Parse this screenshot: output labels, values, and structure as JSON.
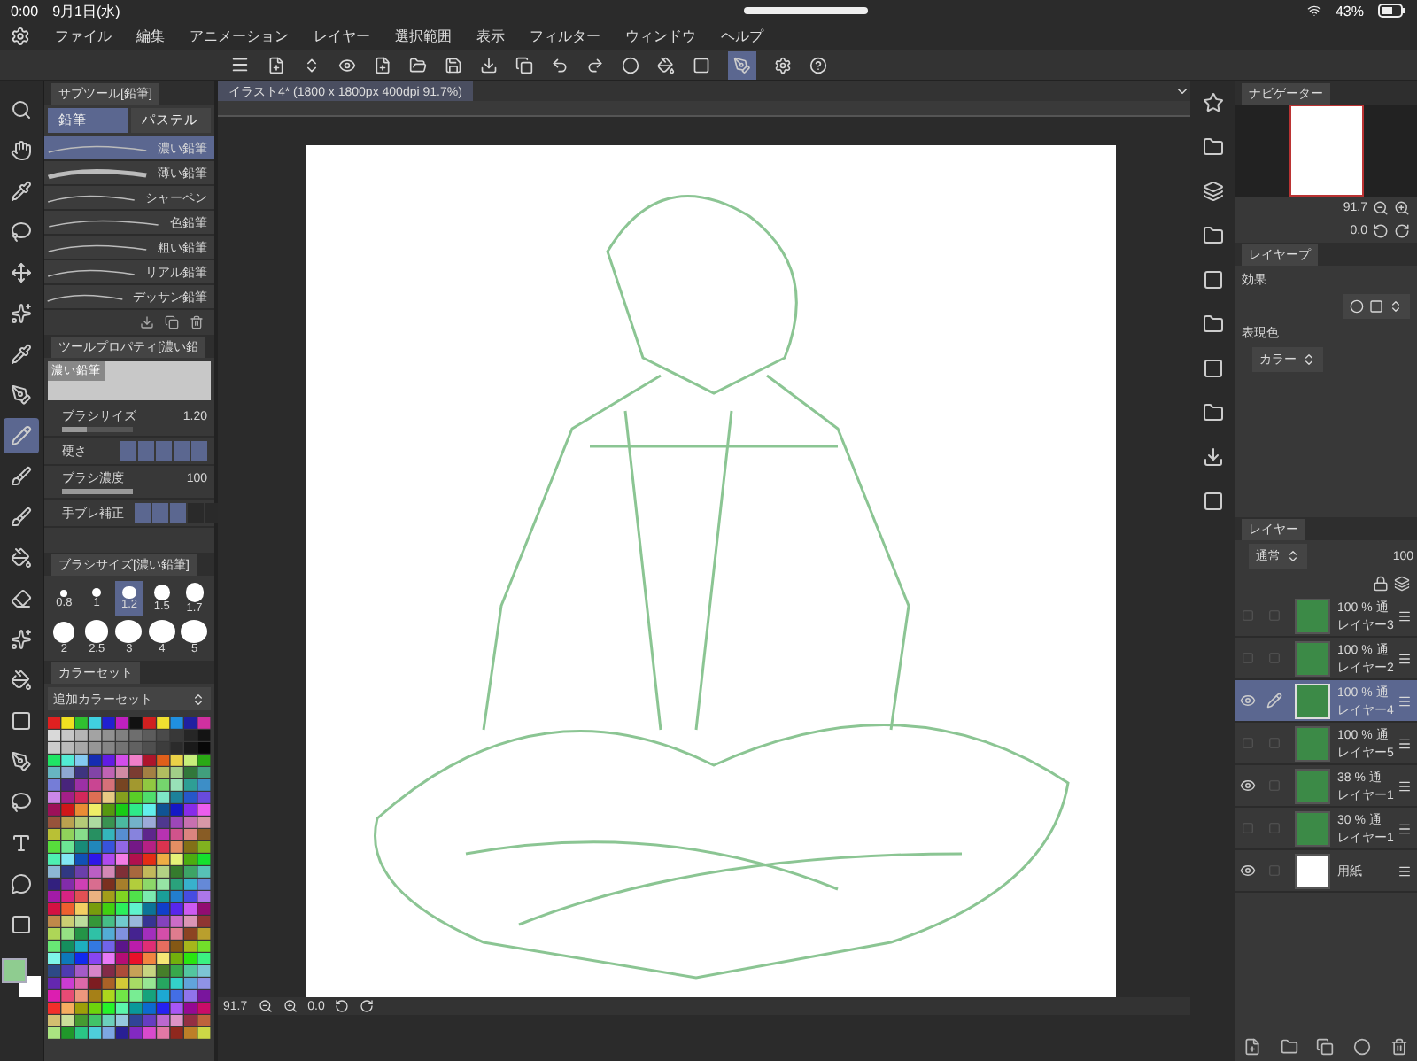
{
  "status_bar": {
    "time": "0:00",
    "date": "9月1日(水)",
    "battery": "43%"
  },
  "menu": [
    "ファイル",
    "編集",
    "アニメーション",
    "レイヤー",
    "選択範囲",
    "表示",
    "フィルター",
    "ウィンドウ",
    "ヘルプ"
  ],
  "tools": [
    {
      "selected": false
    },
    {
      "selected": false
    },
    {
      "selected": false
    },
    {
      "selected": false
    },
    {
      "selected": false
    },
    {
      "selected": false
    },
    {
      "selected": false
    },
    {
      "selected": false
    },
    {
      "selected": true
    },
    {
      "selected": false
    },
    {
      "selected": false
    },
    {
      "selected": false
    },
    {
      "selected": false
    },
    {
      "selected": false
    },
    {
      "selected": false
    },
    {
      "selected": false
    },
    {
      "selected": false
    },
    {
      "selected": false
    },
    {
      "selected": false
    },
    {
      "selected": false
    },
    {
      "selected": false
    }
  ],
  "subtool_panel": {
    "title": "サブツール[鉛筆]",
    "groups": [
      {
        "label": "鉛筆",
        "selected": true
      },
      {
        "label": "パステル",
        "selected": false
      }
    ],
    "brushes": [
      {
        "name": "濃い鉛筆",
        "selected": true
      },
      {
        "name": "薄い鉛筆",
        "selected": false
      },
      {
        "name": "シャーペン",
        "selected": false
      },
      {
        "name": "色鉛筆",
        "selected": false
      },
      {
        "name": "粗い鉛筆",
        "selected": false
      },
      {
        "name": "リアル鉛筆",
        "selected": false
      },
      {
        "name": "デッサン鉛筆",
        "selected": false
      }
    ]
  },
  "tool_property": {
    "title": "ツールプロパティ[濃い鉛",
    "preview_label": "濃い鉛筆",
    "rows": [
      {
        "kind": "value",
        "label": "ブラシサイズ",
        "value": "1.20",
        "level": 0.35
      },
      {
        "kind": "steps",
        "label": "硬さ",
        "level": 1
      },
      {
        "kind": "value",
        "label": "ブラシ濃度",
        "value": "100",
        "level": 1
      },
      {
        "kind": "steps",
        "label": "手ブレ補正",
        "level": 0.6
      }
    ]
  },
  "brush_size": {
    "title": "ブラシサイズ[濃い鉛筆]",
    "sizes": [
      {
        "label": "0.8",
        "selected": false
      },
      {
        "label": "1",
        "selected": false
      },
      {
        "label": "1.2",
        "selected": true
      },
      {
        "label": "1.5",
        "selected": false
      },
      {
        "label": "1.7",
        "selected": false
      },
      {
        "label": "2",
        "selected": false
      },
      {
        "label": "2.5",
        "selected": false
      },
      {
        "label": "3",
        "selected": false
      },
      {
        "label": "4",
        "selected": false
      },
      {
        "label": "5",
        "selected": false
      }
    ]
  },
  "color_set": {
    "title": "カラーセット",
    "set_name": "追加カラーセット"
  },
  "document": {
    "tab": "イラスト4* (1800 x 1800px 400dpi 91.7%)",
    "zoom": "91.7",
    "angle": "0.0"
  },
  "navigator": {
    "title": "ナビゲーター",
    "zoom": "91.7",
    "angle": "0.0"
  },
  "layer_property": {
    "title": "レイヤープ",
    "effect_label": "効果",
    "expression_label": "表現色",
    "expression_value": "カラー"
  },
  "layers_panel": {
    "title": "レイヤー",
    "blend": "通常",
    "opacity": "100",
    "layers": [
      {
        "kind": "raster",
        "opacity": "100 % 通",
        "name": "レイヤー3",
        "visible": false,
        "selected": false,
        "editing": false
      },
      {
        "kind": "raster",
        "opacity": "100 % 通",
        "name": "レイヤー2",
        "visible": false,
        "selected": false,
        "editing": false
      },
      {
        "kind": "raster",
        "opacity": "100 % 通",
        "name": "レイヤー4",
        "visible": true,
        "selected": true,
        "editing": true
      },
      {
        "kind": "raster",
        "opacity": "100 % 通",
        "name": "レイヤー5",
        "visible": false,
        "selected": false,
        "editing": false
      },
      {
        "kind": "raster",
        "opacity": "38 % 通",
        "name": "レイヤー1",
        "visible": true,
        "selected": false,
        "editing": false
      },
      {
        "kind": "raster",
        "opacity": "30 % 通",
        "name": "レイヤー1",
        "visible": false,
        "selected": false,
        "editing": false
      },
      {
        "kind": "paper",
        "name": "用紙",
        "visible": true,
        "selected": false,
        "editing": false
      }
    ]
  }
}
